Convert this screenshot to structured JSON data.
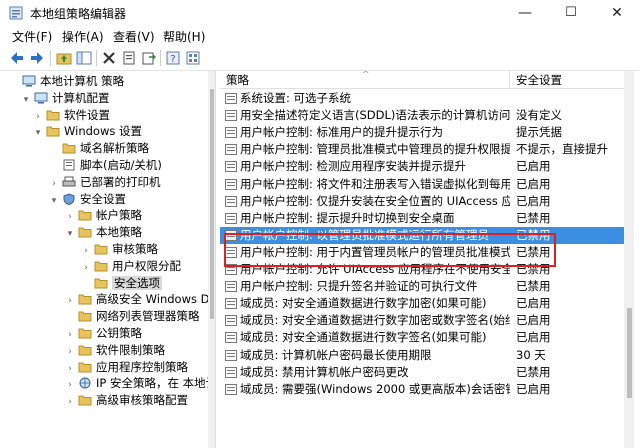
{
  "window": {
    "title": "本地组策略编辑器",
    "minimize": "—",
    "maximize": "☐",
    "close": "✕"
  },
  "menu": [
    "文件(F)",
    "操作(A)",
    "查看(V)",
    "帮助(H)"
  ],
  "toolbar": [
    "back-icon",
    "forward-icon",
    "up-folder-icon",
    "show-tree-icon",
    "delete-icon",
    "properties-icon",
    "export-icon",
    "help-icon",
    "view-icon"
  ],
  "tree": [
    {
      "label": "本地计算机 策略",
      "level": 0,
      "chev": "",
      "icon": "computer"
    },
    {
      "label": "计算机配置",
      "level": 1,
      "chev": "▾",
      "icon": "computer"
    },
    {
      "label": "软件设置",
      "level": 2,
      "chev": "›",
      "icon": "folder"
    },
    {
      "label": "Windows 设置",
      "level": 2,
      "chev": "▾",
      "icon": "folder"
    },
    {
      "label": "域名解析策略",
      "level": 3,
      "chev": "",
      "icon": "folder"
    },
    {
      "label": "脚本(启动/关机)",
      "level": 3,
      "chev": "",
      "icon": "script"
    },
    {
      "label": "已部署的打印机",
      "level": 3,
      "chev": "›",
      "icon": "printer"
    },
    {
      "label": "安全设置",
      "level": 3,
      "chev": "▾",
      "icon": "shield"
    },
    {
      "label": "帐户策略",
      "level": 4,
      "chev": "›",
      "icon": "folder"
    },
    {
      "label": "本地策略",
      "level": 4,
      "chev": "▾",
      "icon": "folder"
    },
    {
      "label": "审核策略",
      "level": 5,
      "chev": "›",
      "icon": "folder"
    },
    {
      "label": "用户权限分配",
      "level": 5,
      "chev": "›",
      "icon": "folder"
    },
    {
      "label": "安全选项",
      "level": 5,
      "chev": "",
      "icon": "folder",
      "selected": true
    },
    {
      "label": "高级安全 Windows Defe",
      "level": 4,
      "chev": "›",
      "icon": "folder"
    },
    {
      "label": "网络列表管理器策略",
      "level": 4,
      "chev": "",
      "icon": "folder"
    },
    {
      "label": "公钥策略",
      "level": 4,
      "chev": "›",
      "icon": "folder"
    },
    {
      "label": "软件限制策略",
      "level": 4,
      "chev": "›",
      "icon": "folder"
    },
    {
      "label": "应用程序控制策略",
      "level": 4,
      "chev": "›",
      "icon": "folder"
    },
    {
      "label": "IP 安全策略，在 本地计算",
      "level": 4,
      "chev": "›",
      "icon": "network"
    },
    {
      "label": "高级审核策略配置",
      "level": 4,
      "chev": "›",
      "icon": "folder"
    }
  ],
  "list": {
    "col_policy": "策略",
    "col_setting": "安全设置",
    "rows": [
      {
        "name": "系统设置: 可选子系统",
        "value": ""
      },
      {
        "name": "用安全描述符定义语言(SDDL)语法表示的计算机访问限制",
        "value": "没有定义"
      },
      {
        "name": "用户帐户控制: 标准用户的提升提示行为",
        "value": "提示凭据"
      },
      {
        "name": "用户帐户控制: 管理员批准模式中管理员的提升权限提示的...",
        "value": "不提示，直接提升"
      },
      {
        "name": "用户帐户控制: 检测应用程序安装并提示提升",
        "value": "已启用"
      },
      {
        "name": "用户帐户控制: 将文件和注册表写入错误虚拟化到每用户位置",
        "value": "已启用"
      },
      {
        "name": "用户帐户控制: 仅提升安装在安全位置的 UIAccess 应用程序",
        "value": "已启用"
      },
      {
        "name": "用户帐户控制: 提示提升时切换到安全桌面",
        "value": "已禁用"
      },
      {
        "name": "用户帐户控制: 以管理员批准模式运行所有管理员",
        "value": "已禁用",
        "selected": true
      },
      {
        "name": "用户帐户控制: 用于内置管理员帐户的管理员批准模式",
        "value": "已禁用"
      },
      {
        "name": "用户帐户控制: 允许 UIAccess 应用程序在不使用安全桌面...",
        "value": "已禁用"
      },
      {
        "name": "用户帐户控制: 只提升签名并验证的可执行文件",
        "value": "已禁用"
      },
      {
        "name": "域成员: 对安全通道数据进行数字加密(如果可能)",
        "value": "已启用"
      },
      {
        "name": "域成员: 对安全通道数据进行数字加密或数字签名(始终)",
        "value": "已启用"
      },
      {
        "name": "域成员: 对安全通道数据进行数字签名(如果可能)",
        "value": "已启用"
      },
      {
        "name": "域成员: 计算机帐户密码最长使用期限",
        "value": "30 天"
      },
      {
        "name": "域成员: 禁用计算机帐户密码更改",
        "value": "已禁用"
      },
      {
        "name": "域成员: 需要强(Windows 2000 或更高版本)会话密钥",
        "value": "已启用"
      }
    ]
  },
  "colors": {
    "selection": "#3b8ee0",
    "highlight_box": "#e02020",
    "folder": "#e8c25a"
  }
}
